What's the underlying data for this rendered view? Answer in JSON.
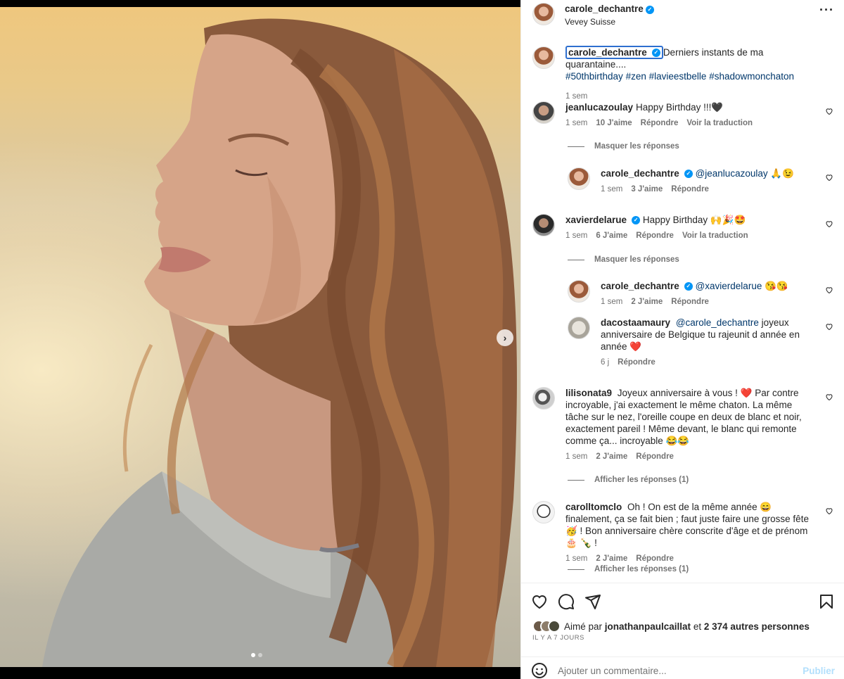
{
  "post": {
    "username": "carole_dechantre",
    "location": "Vevey Suisse",
    "caption_user": "carole_dechantre",
    "caption_text": "Derniers instants de ma quarantaine....",
    "hashtags": [
      "#50thbirthday",
      "#zen",
      "#lavieestbelle",
      "#shadowmonchaton"
    ],
    "caption_time": "1 sem",
    "carousel_total": 2,
    "carousel_active": 1
  },
  "comments": [
    {
      "user": "jeanlucazoulay",
      "text": "Happy Birthday !!!🖤",
      "time": "1 sem",
      "likes": "10 J'aime",
      "reply": "Répondre",
      "translate": "Voir la traduction"
    },
    {
      "user": "carole_dechantre",
      "mention": "@jeanlucazoulay",
      "text": " 🙏😉",
      "time": "1 sem",
      "likes": "3 J'aime",
      "reply": "Répondre"
    },
    {
      "user": "xavierdelarue",
      "text": "Happy Birthday 🙌🎉🤩",
      "time": "1 sem",
      "likes": "6 J'aime",
      "reply": "Répondre",
      "translate": "Voir la traduction"
    },
    {
      "user": "carole_dechantre",
      "mention": "@xavierdelarue",
      "text": " 😘😘",
      "time": "1 sem",
      "likes": "2 J'aime",
      "reply": "Répondre"
    },
    {
      "user": "dacostaamaury",
      "mention": "@carole_dechantre",
      "text": " joyeux anniversaire de Belgique tu rajeunit d année en année ❤️",
      "time": "6 j",
      "reply": "Répondre"
    },
    {
      "user": "lilisonata9",
      "text": "Joyeux anniversaire à vous ! ❤️ Par contre incroyable, j'ai exactement le même chaton. La même tâche sur le nez, l'oreille coupe en deux de blanc et noir, exactement pareil ! Même devant, le blanc qui remonte comme ça... incroyable 😂😂",
      "time": "1 sem",
      "likes": "2 J'aime",
      "reply": "Répondre"
    },
    {
      "user": "carolltomclo",
      "text": "Oh ! On est de la même année 😄 finalement, ça se fait bien ; faut juste faire une grosse fête 🥳 ! Bon anniversaire chère conscrite d'âge et de prénom 🎂 🍾 !",
      "time": "1 sem",
      "likes": "2 J'aime",
      "reply": "Répondre"
    }
  ],
  "reply_toggles": {
    "hide": "Masquer les réponses",
    "show_1": "Afficher les réponses (1)"
  },
  "likes": {
    "prefix": "Aimé par ",
    "user": "jonathanpaulcaillat",
    "suffix": " et ",
    "others": "2 374 autres personnes"
  },
  "time_ago": "IL Y A 7 JOURS",
  "add_comment": {
    "placeholder": "Ajouter un commentaire...",
    "publish": "Publier"
  },
  "colors": {
    "link": "#00376b",
    "verified": "#0095f6",
    "muted": "#737373",
    "publish_disabled": "#b2dffc"
  }
}
